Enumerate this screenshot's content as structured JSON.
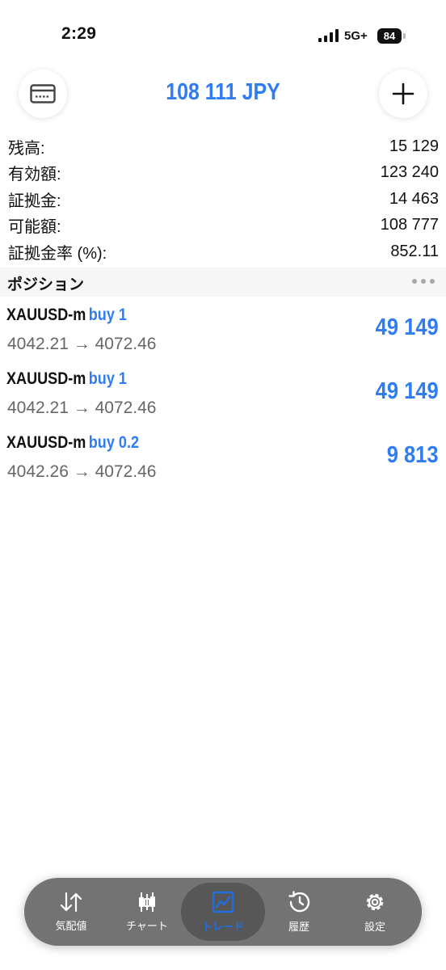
{
  "status_bar": {
    "time": "2:29",
    "network": "5G+",
    "battery": "84"
  },
  "header": {
    "balance": "108 111 JPY",
    "left_icon": "wallet-card-icon",
    "right_icon": "plus-icon"
  },
  "summary": {
    "rows": [
      {
        "label": "残高:",
        "value": "15 129"
      },
      {
        "label": "有効額:",
        "value": "123 240"
      },
      {
        "label": "証拠金:",
        "value": "14 463"
      },
      {
        "label": "可能額:",
        "value": "108 777"
      },
      {
        "label": "証拠金率 (%):",
        "value": "852.11"
      }
    ]
  },
  "positions": {
    "title": "ポジション",
    "items": [
      {
        "symbol": "XAUUSD-m",
        "side": "buy 1",
        "prices": "4042.21 → 4072.46",
        "profit": "49 149"
      },
      {
        "symbol": "XAUUSD-m",
        "side": "buy 1",
        "prices": "4042.21 → 4072.46",
        "profit": "49 149"
      },
      {
        "symbol": "XAUUSD-m",
        "side": "buy 0.2",
        "prices": "4042.26 → 4072.46",
        "profit": "9 813"
      }
    ]
  },
  "tabbar": {
    "active": "トレード",
    "items": [
      {
        "label": "気配値",
        "icon": "up-down-arrows-icon"
      },
      {
        "label": "チャート",
        "icon": "candlestick-icon"
      },
      {
        "label": "トレード",
        "icon": "trade-chart-icon"
      },
      {
        "label": "履歴",
        "icon": "history-clock-icon"
      },
      {
        "label": "設定",
        "icon": "gear-icon"
      }
    ]
  },
  "colors": {
    "accent": "#2f7df0",
    "tabbar_bg": "#737373",
    "tab_active_bg": "#575757",
    "section_bg": "#f6f6f6"
  }
}
